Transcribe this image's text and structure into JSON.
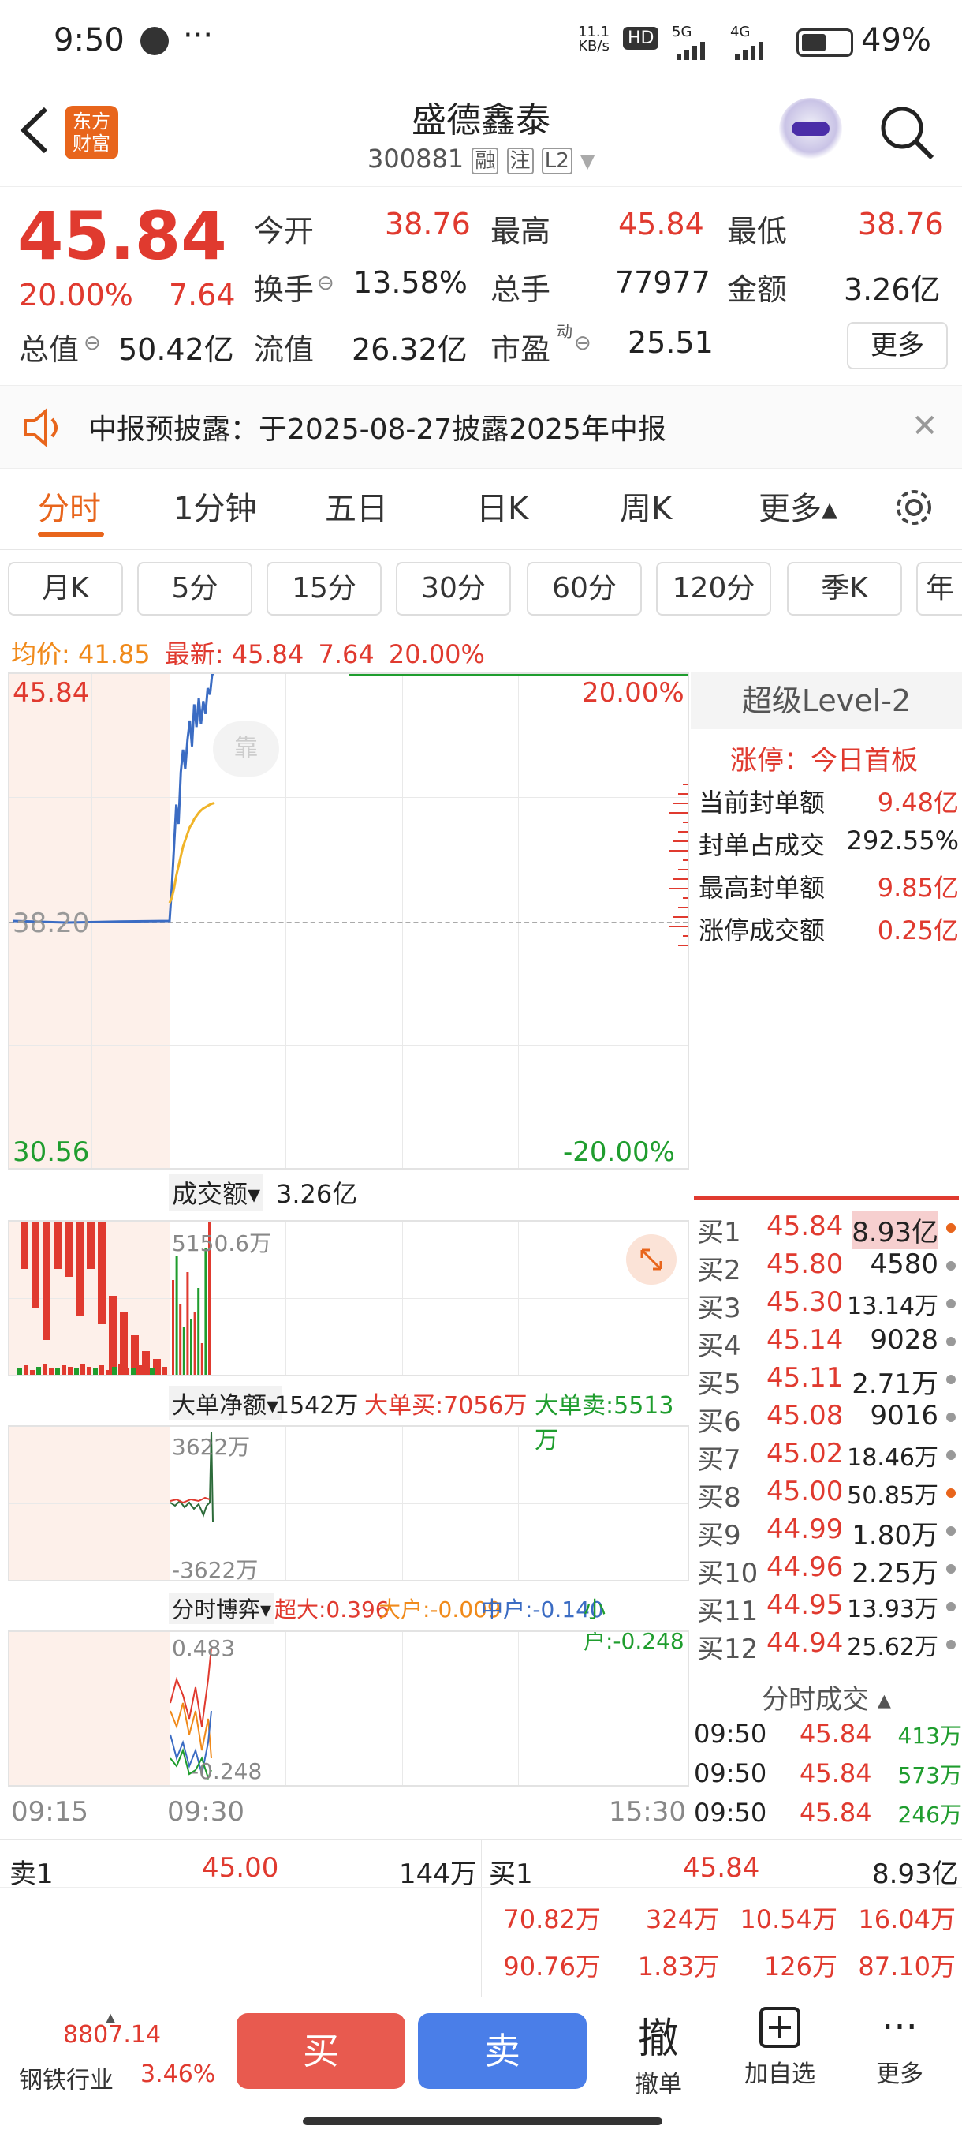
{
  "status_bar": {
    "time": "9:50",
    "net_speed_top": "11.1",
    "net_speed_bottom": "KB/s",
    "hd": "HD",
    "sig1": "5G",
    "sig2": "4G",
    "battery": "49%"
  },
  "header": {
    "logo_line1": "东方",
    "logo_line2": "财富",
    "stock_name": "盛德鑫泰",
    "stock_code": "300881",
    "tag_rong": "融",
    "tag_zhu": "注",
    "tag_l2": "L2"
  },
  "quote": {
    "price": "45.84",
    "change_pct": "20.00%",
    "change": "7.64",
    "open_label": "今开",
    "open": "38.76",
    "high_label": "最高",
    "high": "45.84",
    "low_label": "最低",
    "low": "38.76",
    "turnover_label": "换手",
    "turnover": "13.58%",
    "volume_label": "总手",
    "volume": "77977",
    "amount_label": "金额",
    "amount": "3.26亿",
    "mktcap_label": "总值",
    "mktcap": "50.42亿",
    "float_label": "流值",
    "float": "26.32亿",
    "pe_label": "市盈",
    "pe_sup": "动",
    "pe": "25.51",
    "more": "更多"
  },
  "notice": {
    "text": "中报预披露：于2025-08-27披露2025年中报"
  },
  "tabs": [
    "分时",
    "1分钟",
    "五日",
    "日K",
    "周K",
    "更多▴"
  ],
  "subtabs": [
    "月K",
    "5分",
    "15分",
    "30分",
    "60分",
    "120分",
    "季K",
    "年"
  ],
  "chart": {
    "avg_label": "均价:",
    "avg": "41.85",
    "latest_label": "最新:",
    "latest": "45.84",
    "latest_change": "7.64",
    "latest_pct": "20.00%",
    "y_top": "45.84",
    "y_mid": "38.20",
    "y_bottom": "30.56",
    "pct_top": "20.00%",
    "pct_bottom": "-20.00%",
    "watermark": "靠",
    "vol_label": "成交额▾",
    "vol_total": "3.26亿",
    "vol_max": "5150.6万",
    "net_label": "大单净额▾",
    "net_value": "1542万",
    "big_buy": "大单买:7056万",
    "big_sell": "大单卖:5513万",
    "net_max": "3622万",
    "net_min": "-3622万",
    "game_label": "分时博弈▾",
    "super_large": "超大:0.396",
    "large": "大户:-0.009",
    "medium": "中户:-0.140",
    "small": "小户:-0.248",
    "game_max": "0.483",
    "game_min": "-0.248",
    "t_start": "09:15",
    "t_open": "09:30",
    "t_end": "15:30"
  },
  "chart_data": {
    "type": "line",
    "title": "",
    "x": [
      "09:15",
      "09:20",
      "09:25",
      "09:30",
      "09:31",
      "09:32",
      "09:33",
      "09:34",
      "09:35",
      "09:36",
      "09:37",
      "09:38",
      "09:39",
      "09:40",
      "09:41",
      "09:42",
      "09:43",
      "09:44",
      "09:45",
      "09:46",
      "09:47",
      "09:48",
      "09:49",
      "09:50"
    ],
    "series": [
      {
        "name": "最新",
        "values": [
          38.2,
          38.15,
          38.18,
          38.2,
          39.2,
          40.5,
          41.8,
          41.2,
          42.8,
          43.5,
          42.9,
          43.8,
          44.4,
          43.6,
          44.9,
          44.2,
          45.1,
          44.3,
          45.0,
          44.6,
          45.4,
          45.2,
          45.84,
          45.84
        ]
      },
      {
        "name": "均价",
        "values": [
          null,
          null,
          null,
          38.76,
          38.9,
          39.2,
          39.6,
          39.9,
          40.2,
          40.5,
          40.7,
          40.9,
          41.1,
          41.2,
          41.35,
          41.45,
          41.55,
          41.62,
          41.68,
          41.72,
          41.76,
          41.8,
          41.83,
          41.85
        ]
      }
    ],
    "ylim": [
      30.56,
      45.84
    ],
    "xlabel": "",
    "ylabel": ""
  },
  "level2": {
    "title": "超级Level-2",
    "limit_up": "涨停：今日首板",
    "rows": [
      {
        "label": "当前封单额",
        "value": "9.48亿"
      },
      {
        "label": "封单占成交",
        "value": "292.55%"
      },
      {
        "label": "最高封单额",
        "value": "9.85亿"
      },
      {
        "label": "涨停成交额",
        "value": "0.25亿"
      }
    ]
  },
  "orderbook": [
    {
      "label": "买1",
      "price": "45.84",
      "vol": "8.93亿"
    },
    {
      "label": "买2",
      "price": "45.80",
      "vol": "4580"
    },
    {
      "label": "买3",
      "price": "45.30",
      "vol": "13.14万"
    },
    {
      "label": "买4",
      "price": "45.14",
      "vol": "9028"
    },
    {
      "label": "买5",
      "price": "45.11",
      "vol": "2.71万"
    },
    {
      "label": "买6",
      "price": "45.08",
      "vol": "9016"
    },
    {
      "label": "买7",
      "price": "45.02",
      "vol": "18.46万"
    },
    {
      "label": "买8",
      "price": "45.00",
      "vol": "50.85万"
    },
    {
      "label": "买9",
      "price": "44.99",
      "vol": "1.80万"
    },
    {
      "label": "买10",
      "price": "44.96",
      "vol": "2.25万"
    },
    {
      "label": "买11",
      "price": "44.95",
      "vol": "13.93万"
    },
    {
      "label": "买12",
      "price": "44.94",
      "vol": "25.62万"
    }
  ],
  "ticks_header": "分时成交 ▴",
  "ticks": [
    {
      "time": "09:50",
      "price": "45.84",
      "vol": "413万"
    },
    {
      "time": "09:50",
      "price": "45.84",
      "vol": "573万"
    },
    {
      "time": "09:50",
      "price": "45.84",
      "vol": "246万"
    }
  ],
  "bottom_quotes": {
    "sell1_label": "卖1",
    "sell1_price": "45.00",
    "sell1_vol": "144万",
    "buy1_label": "买1",
    "buy1_price": "45.84",
    "buy1_vol": "8.93亿",
    "grid": [
      [
        "70.82万",
        "324万",
        "10.54万",
        "16.04万"
      ],
      [
        "90.76万",
        "1.83万",
        "126万",
        "87.10万"
      ]
    ]
  },
  "bottom_bar": {
    "index_value": "8807.14",
    "index_name": "钢铁行业",
    "index_pct": "3.46%",
    "buy": "买",
    "sell": "卖",
    "cancel_icon": "撤",
    "cancel": "撤单",
    "add": "加自选",
    "more": "更多"
  },
  "colors": {
    "up": "#e03a2f",
    "down": "#1f9d2e",
    "accent": "#e8651c",
    "buy_btn": "#e85a4f",
    "sell_btn": "#4a7ee8"
  }
}
